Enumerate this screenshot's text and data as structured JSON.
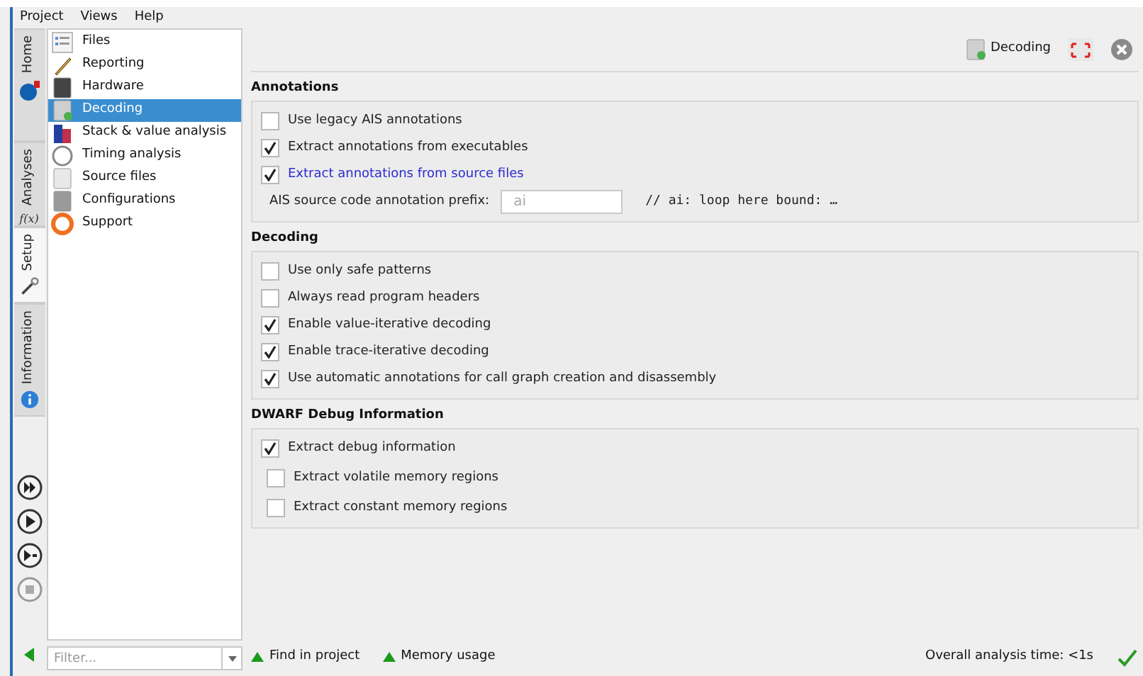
{
  "menu": [
    "Project",
    "Views",
    "Help"
  ],
  "side_tabs": [
    {
      "label": "Home",
      "selected": false
    },
    {
      "label": "Analyses",
      "selected": false,
      "glyph": "f(x)"
    },
    {
      "label": "Setup",
      "selected": true
    },
    {
      "label": "Information",
      "selected": false
    }
  ],
  "tree": [
    {
      "label": "Files",
      "selected": false
    },
    {
      "label": "Reporting",
      "selected": false
    },
    {
      "label": "Hardware",
      "selected": false
    },
    {
      "label": "Decoding",
      "selected": true
    },
    {
      "label": "Stack & value analysis",
      "selected": false
    },
    {
      "label": "Timing analysis",
      "selected": false
    },
    {
      "label": "Source files",
      "selected": false
    },
    {
      "label": "Configurations",
      "selected": false
    },
    {
      "label": "Support",
      "selected": false
    }
  ],
  "filter": {
    "placeholder": "Filter..."
  },
  "header": {
    "title": "Decoding"
  },
  "sections": [
    {
      "title": "Annotations",
      "options": [
        {
          "kind": "checkbox",
          "label": "Use legacy AIS annotations",
          "checked": false,
          "highlighted": false
        },
        {
          "kind": "checkbox",
          "label": "Extract annotations from executables",
          "checked": true,
          "highlighted": false
        },
        {
          "kind": "checkbox",
          "label": "Extract annotations from source files",
          "checked": true,
          "highlighted": true
        },
        {
          "kind": "field",
          "label": "AIS source code annotation prefix:",
          "placeholder": "ai",
          "hint": "// ai: loop here bound: …"
        }
      ]
    },
    {
      "title": "Decoding",
      "options": [
        {
          "kind": "checkbox",
          "label": "Use only safe patterns",
          "checked": false,
          "highlighted": false
        },
        {
          "kind": "checkbox",
          "label": "Always read program headers",
          "checked": false,
          "highlighted": false
        },
        {
          "kind": "checkbox",
          "label": "Enable value-iterative decoding",
          "checked": true,
          "highlighted": false
        },
        {
          "kind": "checkbox",
          "label": "Enable trace-iterative decoding",
          "checked": true,
          "highlighted": false
        },
        {
          "kind": "checkbox",
          "label": "Use automatic annotations for call graph creation and disassembly",
          "checked": true,
          "highlighted": false
        }
      ]
    },
    {
      "title": "DWARF Debug Information",
      "options": [
        {
          "kind": "checkbox",
          "label": "Extract debug information",
          "checked": true,
          "highlighted": false,
          "children": [
            {
              "kind": "checkbox",
              "label": "Extract volatile memory regions",
              "checked": false,
              "highlighted": false
            },
            {
              "kind": "checkbox",
              "label": "Extract constant memory regions",
              "checked": false,
              "highlighted": false
            }
          ]
        }
      ]
    }
  ],
  "status": {
    "links": [
      "Find in project",
      "Memory usage"
    ],
    "time": "Overall analysis time: <1s"
  }
}
